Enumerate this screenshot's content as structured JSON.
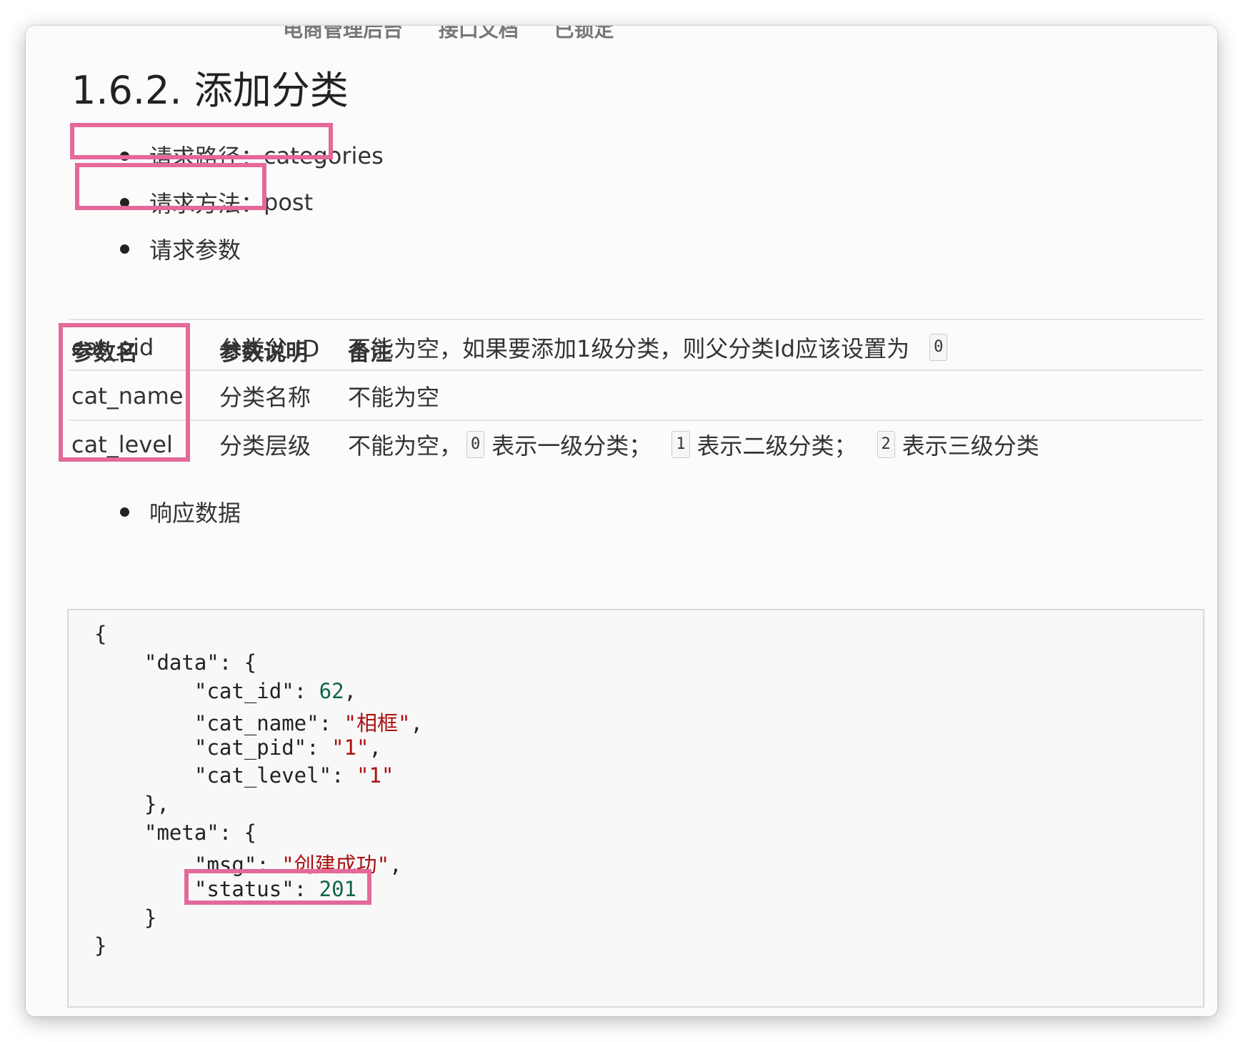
{
  "header_fragment": [
    "电商管理后台",
    "接口文档",
    "已锁定"
  ],
  "title": "1.6.2. 添加分类",
  "bullets": {
    "path_label": "请求路径：",
    "path_value": "categories",
    "method_label": "请求方法：",
    "method_value": "post",
    "params_label": "请求参数",
    "response_label": "响应数据"
  },
  "table": {
    "headers": [
      "参数名",
      "参数说明",
      "备注"
    ],
    "rows": [
      {
        "name": "cat_pid",
        "desc": "分类父 ID",
        "note": "不能为空，如果要添加1级分类，则父分类Id应该设置为",
        "note_code": "0"
      },
      {
        "name": "cat_name",
        "desc": "分类名称",
        "note": "不能为空"
      },
      {
        "name": "cat_level",
        "desc": "分类层级",
        "note_parts": [
          "不能为空，",
          "0",
          "表示一级分类；",
          "1",
          "表示二级分类；",
          "2",
          "表示三级分类"
        ]
      }
    ]
  },
  "code": {
    "open": "{",
    "data_key": "\"data\": {",
    "cat_id_key": "\"cat_id\": ",
    "cat_id_val": "62",
    "cat_name_key": "\"cat_name\": ",
    "cat_name_val": "\"相框\"",
    "cat_pid_key": "\"cat_pid\": ",
    "cat_pid_val": "\"1\"",
    "cat_level_key": "\"cat_level\": ",
    "cat_level_val": "\"1\"",
    "data_close": "},",
    "meta_key": "\"meta\": {",
    "msg_key": "\"msg\": ",
    "msg_val": "\"创建成功\"",
    "status_key": "\"status\": ",
    "status_val": "201",
    "meta_close": "}",
    "close": "}"
  },
  "colors": {
    "highlight": "#e4699a",
    "number": "#116644",
    "string": "#aa1111"
  }
}
